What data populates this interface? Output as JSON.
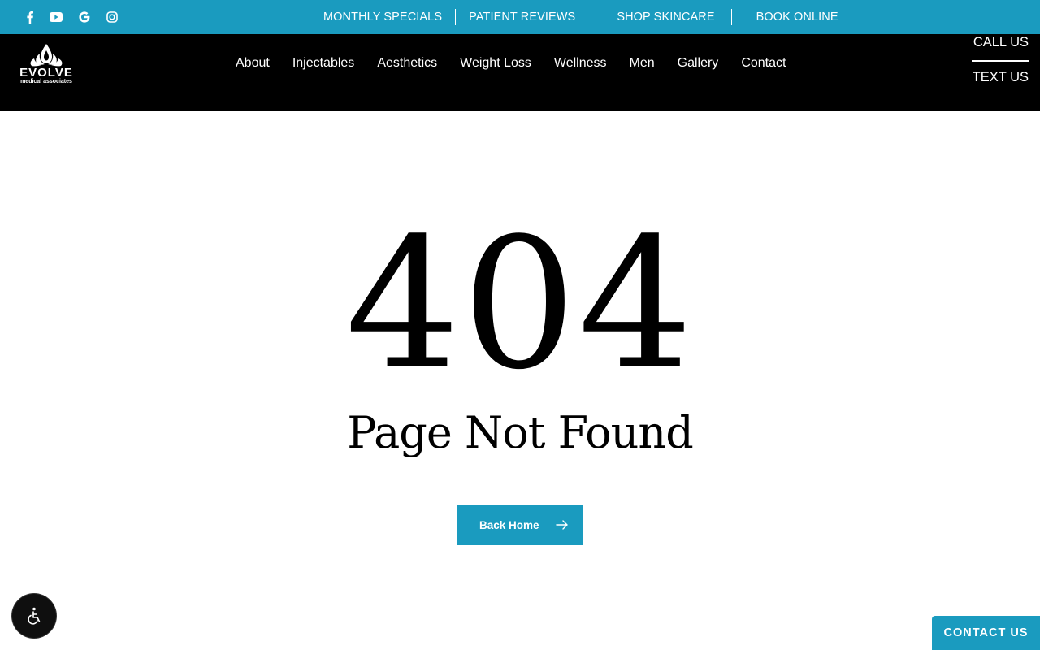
{
  "social": [
    {
      "name": "facebook-icon"
    },
    {
      "name": "youtube-icon"
    },
    {
      "name": "google-icon"
    },
    {
      "name": "instagram-icon"
    }
  ],
  "toplinks": [
    "MONTHLY SPECIALS",
    "PATIENT REVIEWS",
    "SHOP SKINCARE",
    "BOOK ONLINE"
  ],
  "logo": {
    "word": "EVOLVE",
    "sub": "medical associates"
  },
  "nav": [
    "About",
    "Injectables",
    "Aesthetics",
    "Weight Loss",
    "Wellness",
    "Men",
    "Gallery",
    "Contact"
  ],
  "cta": {
    "call": "CALL US",
    "text": "TEXT US"
  },
  "error": {
    "code": "404",
    "message": "Page Not Found",
    "button": "Back Home"
  },
  "contact_tab": "CONTACT US",
  "colors": {
    "accent": "#1a9bbf",
    "header": "#000000",
    "background": "#ffffff"
  }
}
